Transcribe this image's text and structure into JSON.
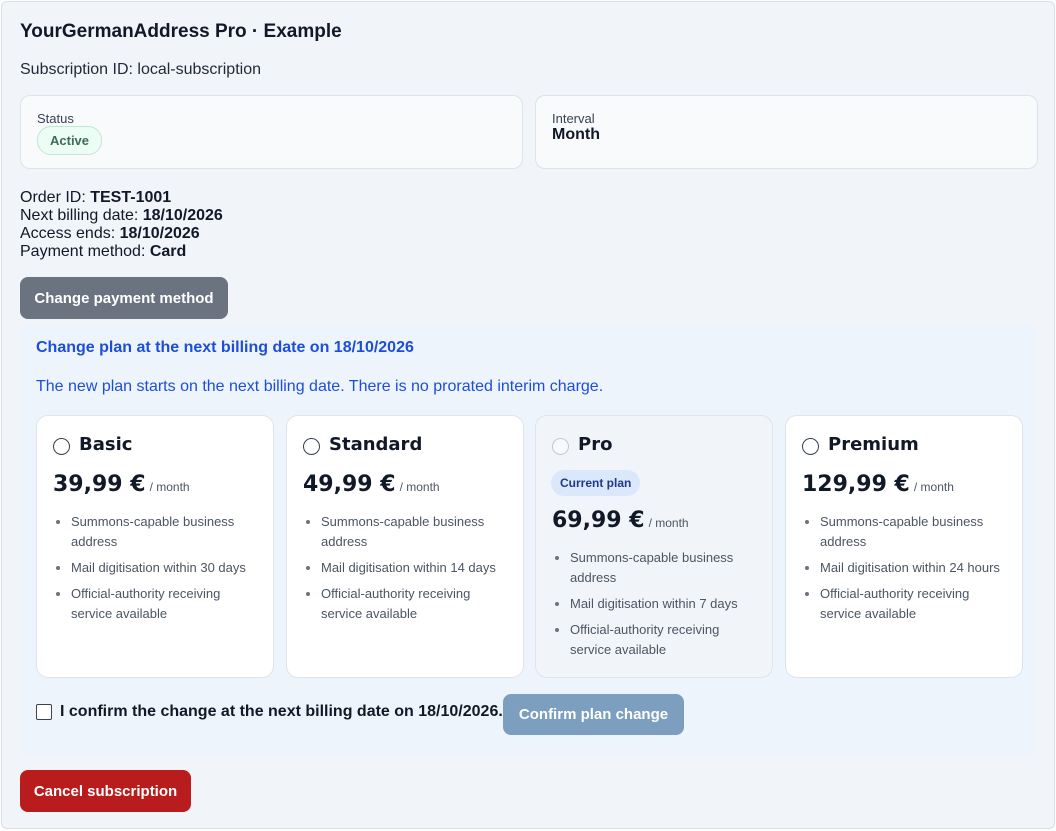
{
  "header": {
    "title": "YourGermanAddress Pro · Example",
    "subscription_label": "Subscription ID: local-subscription"
  },
  "status_card": {
    "label": "Status",
    "value": "Active"
  },
  "interval_card": {
    "label": "Interval",
    "value": "Month"
  },
  "details": [
    {
      "label": "Order ID: ",
      "value": "TEST-1001"
    },
    {
      "label": "Next billing date: ",
      "value": "18/10/2026"
    },
    {
      "label": "Access ends: ",
      "value": "18/10/2026"
    },
    {
      "label": "Payment method: ",
      "value": "Card"
    }
  ],
  "buttons": {
    "change_payment": "Change payment method",
    "confirm_plan": "Confirm plan change",
    "cancel_subscription": "Cancel subscription"
  },
  "plan_change": {
    "heading": "Change plan at the next billing date on 18/10/2026",
    "note": "The new plan starts on the next billing date. There is no prorated interim charge.",
    "confirm_label": "I confirm the change at the next billing date on 18/10/2026.",
    "current_badge": "Current plan"
  },
  "plans": [
    {
      "name": "Basic",
      "price": "39,99 €",
      "period": "/ month",
      "current": false,
      "features": [
        "Summons-capable business address",
        "Mail digitisation within 30 days",
        "Official-authority receiving service available"
      ]
    },
    {
      "name": "Standard",
      "price": "49,99 €",
      "period": "/ month",
      "current": false,
      "features": [
        "Summons-capable business address",
        "Mail digitisation within 14 days",
        "Official-authority receiving service available"
      ]
    },
    {
      "name": "Pro",
      "price": "69,99 €",
      "period": "/ month",
      "current": true,
      "features": [
        "Summons-capable business address",
        "Mail digitisation within 7 days",
        "Official-authority receiving service available"
      ]
    },
    {
      "name": "Premium",
      "price": "129,99 €",
      "period": "/ month",
      "current": false,
      "features": [
        "Summons-capable business address",
        "Mail digitisation within 24 hours",
        "Official-authority receiving service available"
      ]
    }
  ],
  "colors": {
    "accent_blue": "#1d4ed8",
    "danger_red": "#b91c1c",
    "status_green": "#3f6b57",
    "neutral_gray": "#6b7280"
  }
}
